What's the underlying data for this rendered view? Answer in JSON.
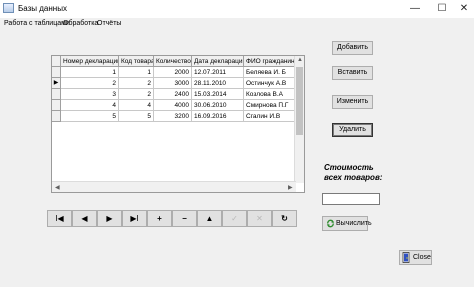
{
  "window": {
    "title": "Базы данных",
    "minimize": "—",
    "maximize": "☐",
    "close": "✕"
  },
  "menu": [
    "Работа с таблицами",
    "Обработка",
    "Отчёты"
  ],
  "table": {
    "columns": [
      "Номер декларации",
      "Код товара",
      "Количество",
      "Дата декларации",
      "ФИО гражданина"
    ],
    "rows": [
      [
        "1",
        "1",
        "2000",
        "12.07.2011",
        "Беляева И. Б"
      ],
      [
        "2",
        "2",
        "3000",
        "28.11.2010",
        "Остинчук А.В"
      ],
      [
        "3",
        "2",
        "2400",
        "15.03.2014",
        "Козлова В.А"
      ],
      [
        "4",
        "4",
        "4000",
        "30.06.2010",
        "Смирнова П.Г"
      ],
      [
        "5",
        "5",
        "3200",
        "16.09.2016",
        "Сгалин И.В"
      ]
    ],
    "current_row_marker": "▶",
    "current_row_index": 1
  },
  "navigator": {
    "first": "I◀",
    "prior": "◀",
    "next": "▶",
    "last": "▶I",
    "insert": "+",
    "delete": "−",
    "edit": "▲",
    "post": "✓",
    "cancel": "✕",
    "refresh": "↻"
  },
  "buttons": {
    "add": "Добавить",
    "insert": "Вставить",
    "change": "Изменить",
    "remove": "Удалить",
    "calculate": "Вычислить",
    "close": "Close"
  },
  "total": {
    "label_line1": "Стоимость",
    "label_line2": "всех товаров:",
    "value": ""
  }
}
